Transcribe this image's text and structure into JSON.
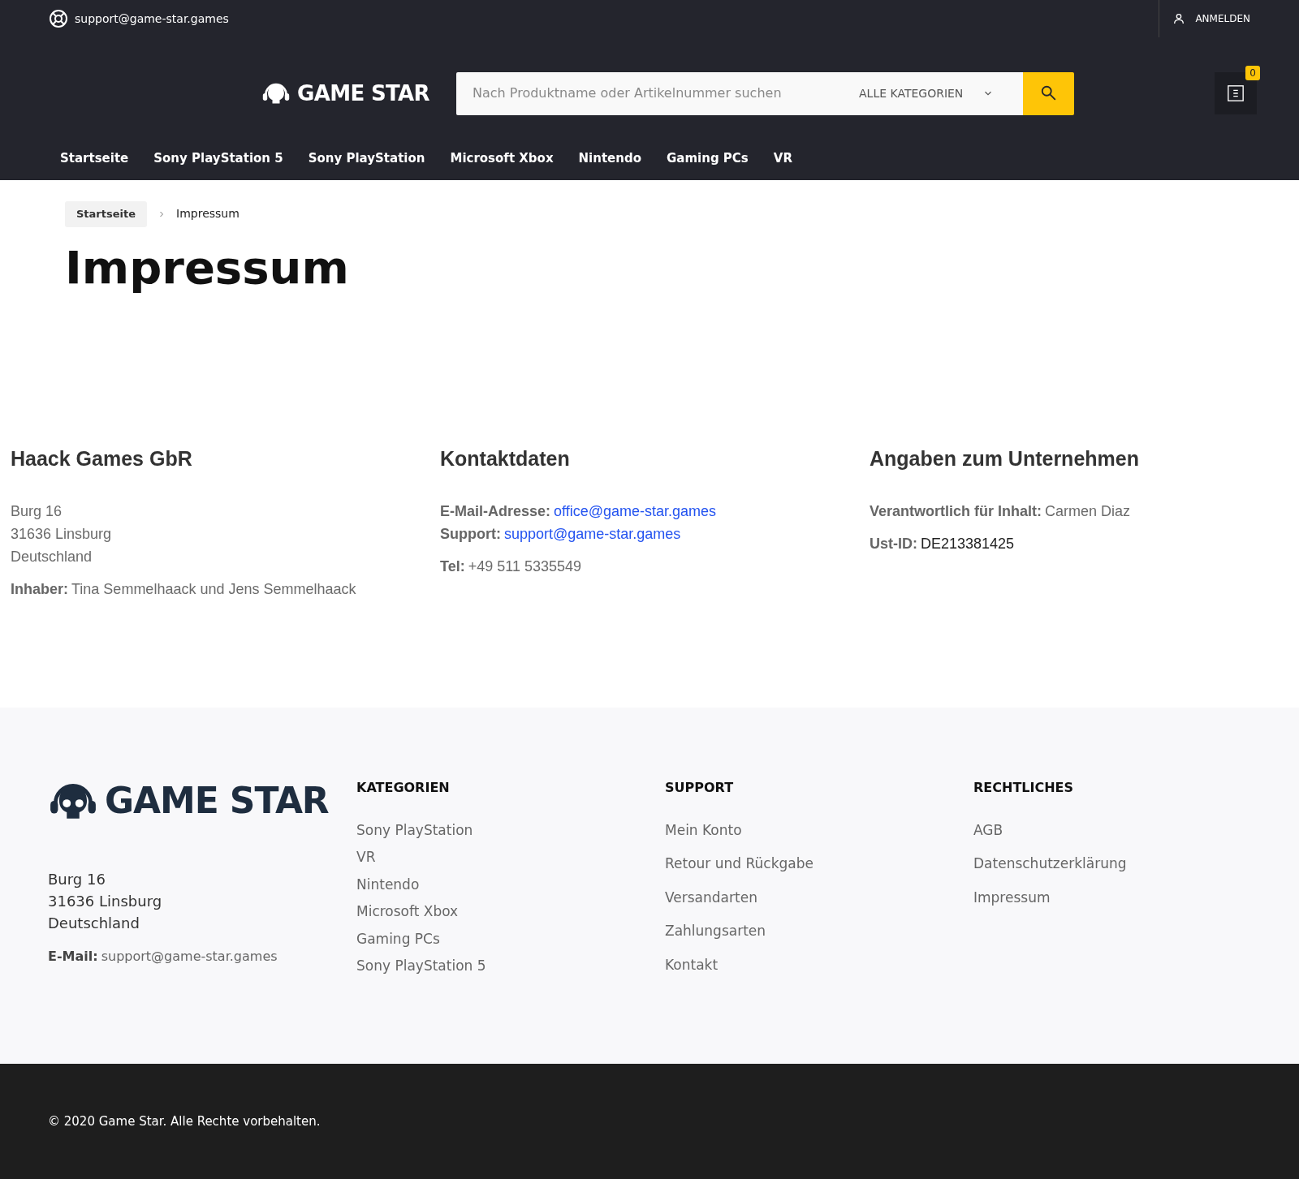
{
  "topbar": {
    "email": "support@game-star.games",
    "login": "ANMELDEN"
  },
  "header": {
    "logo": "GAME STAR",
    "search": {
      "placeholder": "Nach Produktname oder Artikelnummer suchen"
    },
    "category": "ALLE KATEGORIEN",
    "cart_count": "0"
  },
  "nav": [
    {
      "label": "Startseite"
    },
    {
      "label": "Sony PlayStation 5"
    },
    {
      "label": "Sony PlayStation"
    },
    {
      "label": "Microsoft Xbox"
    },
    {
      "label": "Nintendo"
    },
    {
      "label": "Gaming PCs"
    },
    {
      "label": "VR"
    }
  ],
  "breadcrumb": [
    {
      "label": "Startseite",
      "kind": "link"
    },
    {
      "label": "Impressum",
      "kind": "current"
    }
  ],
  "title": "Impressum",
  "columns": [
    {
      "heading": "Haack Games GbR",
      "blocks": [
        [
          {
            "value": "Burg 16",
            "kind": "text"
          },
          {
            "value": "31636 Linsburg",
            "kind": "text"
          },
          {
            "value": "Deutschland",
            "kind": "text"
          }
        ],
        [
          {
            "label": "Inhaber:",
            "value": "Tina Semmelhaack und Jens Semmelhaack",
            "kind": "text"
          }
        ]
      ]
    },
    {
      "heading": "Kontaktdaten",
      "blocks": [
        [
          {
            "label": "E-Mail-Adresse:",
            "value": "office@game-star.games",
            "kind": "link"
          },
          {
            "label": "Support:",
            "value": "support@game-star.games",
            "kind": "link"
          }
        ],
        [
          {
            "label": "Tel:",
            "value": "+49 511 5335549",
            "kind": "text"
          }
        ]
      ]
    },
    {
      "heading": "Angaben zum Unternehmen",
      "blocks": [
        [
          {
            "label": "Verantwortlich für Inhalt:",
            "value": "Carmen Diaz",
            "kind": "text"
          }
        ],
        [
          {
            "label": "Ust-ID:",
            "value": "DE213381425",
            "kind": "dark"
          }
        ]
      ]
    }
  ],
  "footer": {
    "logo": "GAME STAR",
    "address": [
      "Burg 16",
      "31636 Linsburg",
      "Deutschland"
    ],
    "email_label": "E-Mail:",
    "email": "support@game-star.games",
    "columns": [
      {
        "heading": "KATEGORIEN",
        "links": [
          "Sony PlayStation",
          "VR",
          "Nintendo",
          "Microsoft Xbox",
          "Gaming PCs",
          "Sony PlayStation 5"
        ]
      },
      {
        "heading": "SUPPORT",
        "links": [
          "Mein Konto",
          "Retour und Rückgabe",
          "Versandarten",
          "Zahlungsarten",
          "Kontakt"
        ]
      },
      {
        "heading": "RECHTLICHES",
        "links": [
          "AGB",
          "Datenschutzerklärung",
          "Impressum"
        ]
      }
    ]
  },
  "copyright": "© 2020 Game Star. Alle Rechte vorbehalten."
}
